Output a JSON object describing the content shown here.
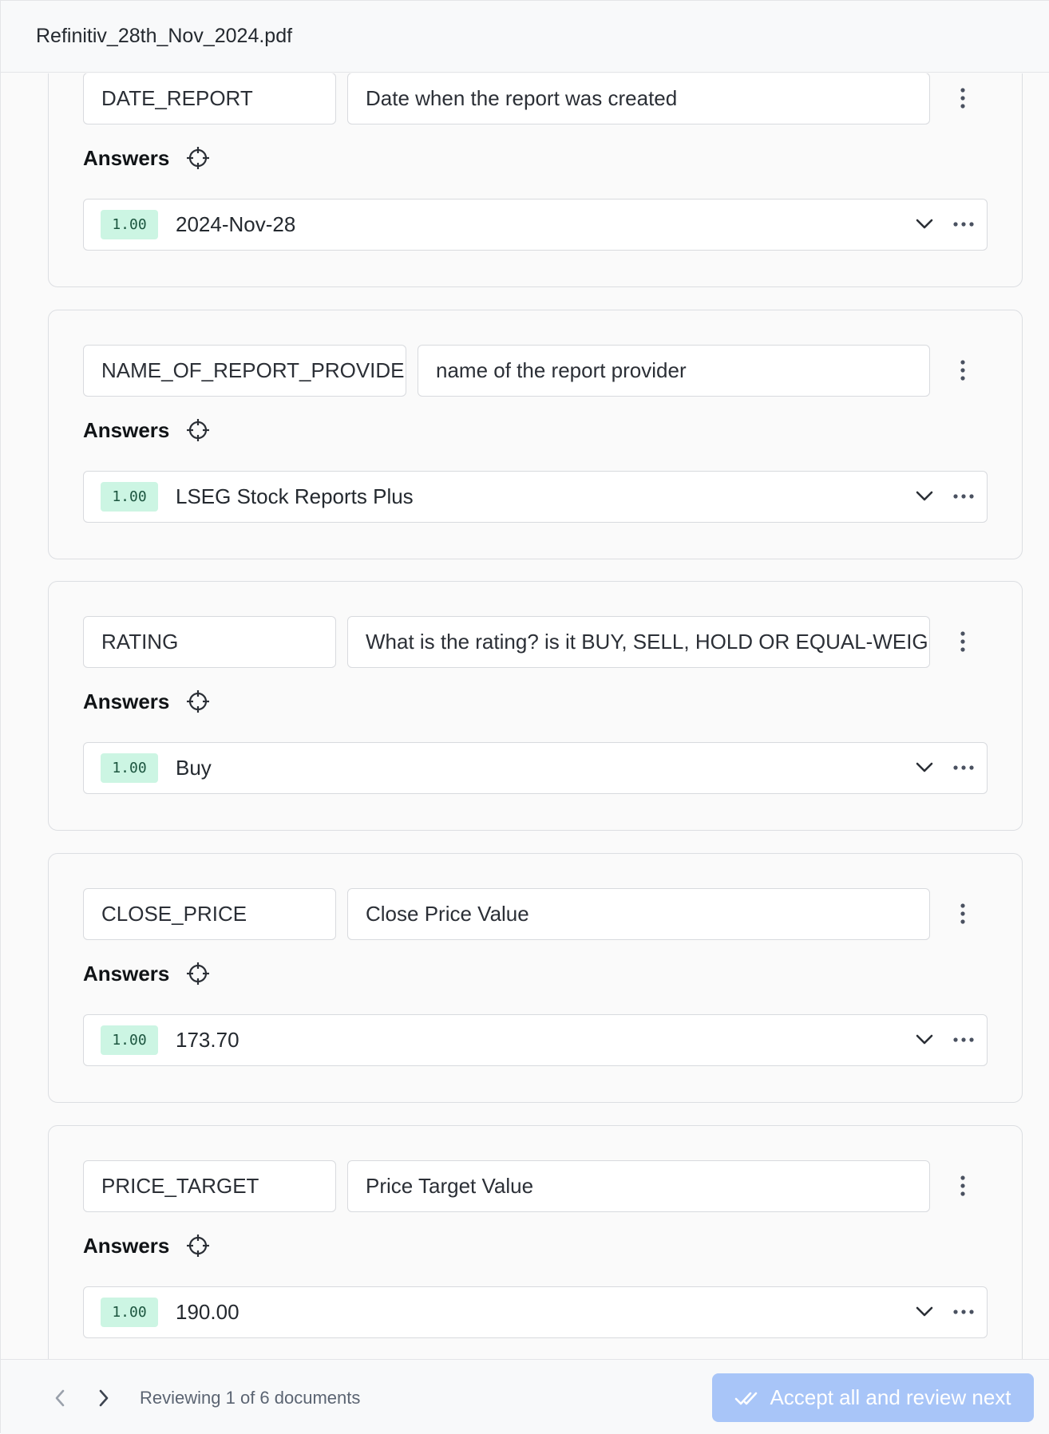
{
  "header": {
    "title": "Refinitiv_28th_Nov_2024.pdf"
  },
  "fields": [
    {
      "name": "DATE_REPORT",
      "description": "Date when the report was created",
      "answers_label": "Answers",
      "answer": {
        "score": "1.00",
        "value": "2024-Nov-28"
      }
    },
    {
      "name": "NAME_OF_REPORT_PROVIDER",
      "description": "name of the report provider",
      "answers_label": "Answers",
      "answer": {
        "score": "1.00",
        "value": "LSEG Stock Reports Plus"
      }
    },
    {
      "name": "RATING",
      "description": "What is the rating? is it BUY, SELL, HOLD OR EQUAL-WEIG",
      "answers_label": "Answers",
      "answer": {
        "score": "1.00",
        "value": "Buy"
      }
    },
    {
      "name": "CLOSE_PRICE",
      "description": "Close Price Value",
      "answers_label": "Answers",
      "answer": {
        "score": "1.00",
        "value": "173.70"
      }
    },
    {
      "name": "PRICE_TARGET",
      "description": "Price Target Value",
      "answers_label": "Answers",
      "answer": {
        "score": "1.00",
        "value": "190.00"
      }
    }
  ],
  "footer": {
    "review_status": "Reviewing 1 of 6 documents",
    "accept_label": "Accept all and review next"
  },
  "icons": {
    "field_menu": "kebab-menu-icon",
    "locate": "crosshair-icon",
    "expand": "chevron-down-icon",
    "answer_menu": "more-horizontal-icon",
    "prev": "chevron-left-icon",
    "next": "chevron-right-icon",
    "accept": "double-check-icon"
  },
  "colors": {
    "score_badge_bg": "#ccf5e3",
    "accept_button_bg": "#a8c5f8"
  }
}
